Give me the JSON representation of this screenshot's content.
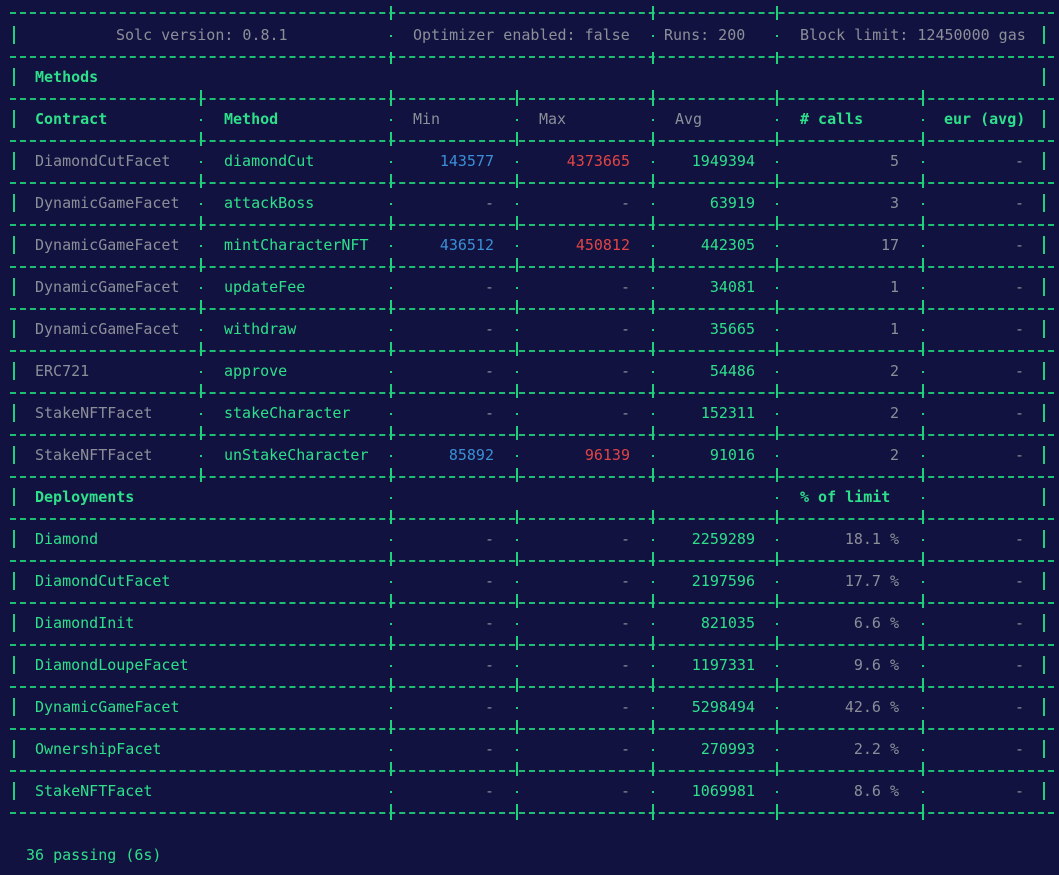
{
  "header": {
    "solc": "Solc version: 0.8.1",
    "optimizer": "Optimizer enabled: false",
    "runs": "Runs: 200",
    "block_limit": "Block limit: 12450000 gas"
  },
  "methods_section": {
    "title": "Methods",
    "columns": [
      "Contract",
      "Method",
      "Min",
      "Max",
      "Avg",
      "# calls",
      "eur (avg)"
    ],
    "rows": [
      {
        "contract": "DiamondCutFacet",
        "method": "diamondCut",
        "min": "143577",
        "max": "4373665",
        "avg": "1949394",
        "calls": "5",
        "eur": "-"
      },
      {
        "contract": "DynamicGameFacet",
        "method": "attackBoss",
        "min": "-",
        "max": "-",
        "avg": "63919",
        "calls": "3",
        "eur": "-"
      },
      {
        "contract": "DynamicGameFacet",
        "method": "mintCharacterNFT",
        "min": "436512",
        "max": "450812",
        "avg": "442305",
        "calls": "17",
        "eur": "-"
      },
      {
        "contract": "DynamicGameFacet",
        "method": "updateFee",
        "min": "-",
        "max": "-",
        "avg": "34081",
        "calls": "1",
        "eur": "-"
      },
      {
        "contract": "DynamicGameFacet",
        "method": "withdraw",
        "min": "-",
        "max": "-",
        "avg": "35665",
        "calls": "1",
        "eur": "-"
      },
      {
        "contract": "ERC721",
        "method": "approve",
        "min": "-",
        "max": "-",
        "avg": "54486",
        "calls": "2",
        "eur": "-"
      },
      {
        "contract": "StakeNFTFacet",
        "method": "stakeCharacter",
        "min": "-",
        "max": "-",
        "avg": "152311",
        "calls": "2",
        "eur": "-"
      },
      {
        "contract": "StakeNFTFacet",
        "method": "unStakeCharacter",
        "min": "85892",
        "max": "96139",
        "avg": "91016",
        "calls": "2",
        "eur": "-"
      }
    ]
  },
  "deployments_section": {
    "title": "Deployments",
    "limit_header": "% of limit",
    "rows": [
      {
        "name": "Diamond",
        "min": "-",
        "max": "-",
        "avg": "2259289",
        "pct": "18.1 %",
        "eur": "-"
      },
      {
        "name": "DiamondCutFacet",
        "min": "-",
        "max": "-",
        "avg": "2197596",
        "pct": "17.7 %",
        "eur": "-"
      },
      {
        "name": "DiamondInit",
        "min": "-",
        "max": "-",
        "avg": "821035",
        "pct": "6.6 %",
        "eur": "-"
      },
      {
        "name": "DiamondLoupeFacet",
        "min": "-",
        "max": "-",
        "avg": "1197331",
        "pct": "9.6 %",
        "eur": "-"
      },
      {
        "name": "DynamicGameFacet",
        "min": "-",
        "max": "-",
        "avg": "5298494",
        "pct": "42.6 %",
        "eur": "-"
      },
      {
        "name": "OwnershipFacet",
        "min": "-",
        "max": "-",
        "avg": "270993",
        "pct": "2.2 %",
        "eur": "-"
      },
      {
        "name": "StakeNFTFacet",
        "min": "-",
        "max": "-",
        "avg": "1069981",
        "pct": "8.6 %",
        "eur": "-"
      }
    ]
  },
  "footer": {
    "passing": "36 passing (6s)"
  },
  "colors": {
    "background": "#121240",
    "green": "#2de08a",
    "grey": "#8a8f98",
    "blue": "#3a8fd6",
    "red": "#e04545"
  }
}
